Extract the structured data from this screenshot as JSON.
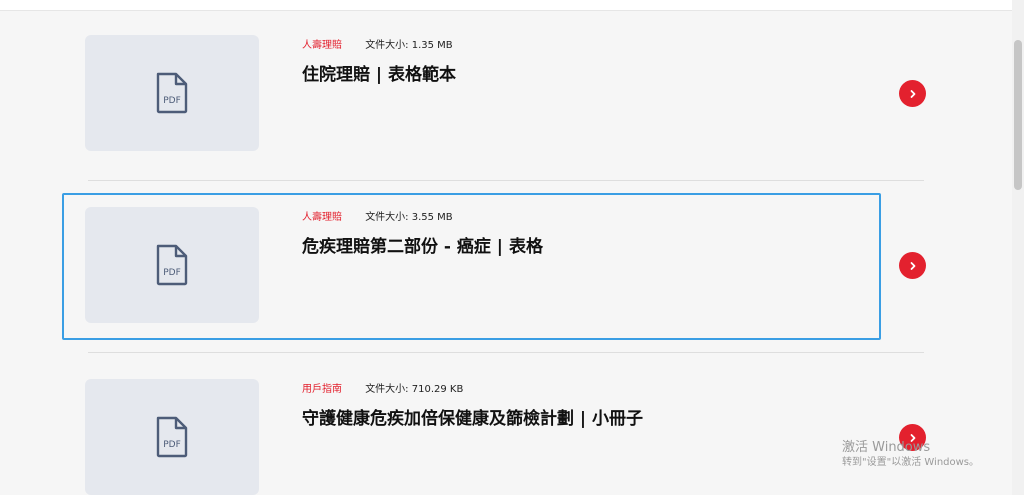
{
  "items": [
    {
      "category": "人壽理賠",
      "filesize": "文件大小: 1.35 MB",
      "title": "住院理賠 | 表格範本",
      "file_badge": "PDF",
      "icon": "pdf-file-icon"
    },
    {
      "category": "人壽理賠",
      "filesize": "文件大小: 3.55 MB",
      "title": "危疾理賠第二部份 - 癌症 | 表格",
      "file_badge": "PDF",
      "icon": "pdf-file-icon"
    },
    {
      "category": "用戶指南",
      "filesize": "文件大小: 710.29 KB",
      "title": "守護健康危疾加倍保健康及篩檢計劃 | 小冊子",
      "file_badge": "PDF",
      "icon": "pdf-file-icon"
    }
  ],
  "watermark": {
    "line1": "激活 Windows",
    "line2": "转到\"设置\"以激活 Windows。"
  },
  "colors": {
    "accent": "#e3212e",
    "focus": "#3a9ee4",
    "thumb_bg": "#e5e8ee"
  }
}
